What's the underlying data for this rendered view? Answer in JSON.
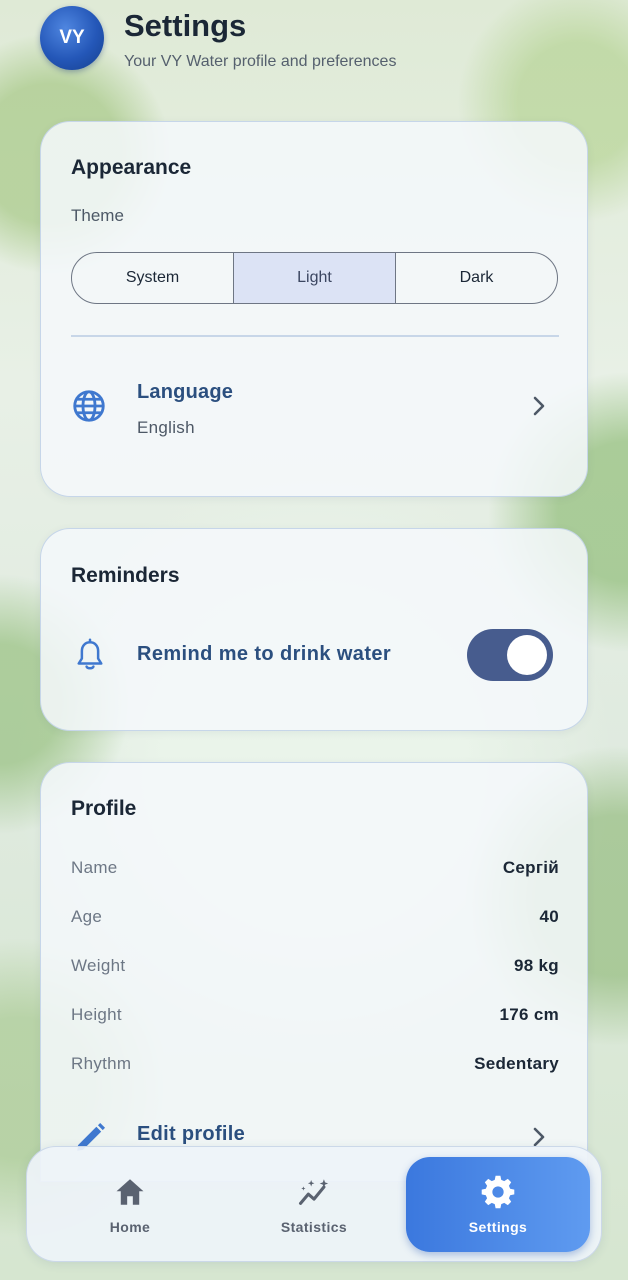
{
  "header": {
    "avatar_initials": "VY",
    "title": "Settings",
    "subtitle": "Your VY Water profile and preferences"
  },
  "appearance": {
    "title": "Appearance",
    "theme_label": "Theme",
    "theme_options": [
      "System",
      "Light",
      "Dark"
    ],
    "theme_selected": "Light",
    "language_title": "Language",
    "language_value": "English"
  },
  "reminders": {
    "title": "Reminders",
    "remind_label": "Remind me to drink water",
    "remind_enabled": true
  },
  "profile": {
    "title": "Profile",
    "rows": [
      {
        "key": "Name",
        "value": "Сергій"
      },
      {
        "key": "Age",
        "value": "40"
      },
      {
        "key": "Weight",
        "value": "98 kg"
      },
      {
        "key": "Height",
        "value": "176 cm"
      },
      {
        "key": "Rhythm",
        "value": "Sedentary"
      }
    ],
    "edit_label": "Edit profile"
  },
  "nav": {
    "items": [
      {
        "label": "Home",
        "icon": "home-icon"
      },
      {
        "label": "Statistics",
        "icon": "statistics-icon"
      },
      {
        "label": "Settings",
        "icon": "gear-icon"
      }
    ],
    "active": "Settings"
  },
  "colors": {
    "accent": "#3b78de",
    "toggle_on": "#475c8e",
    "link_text": "#2b4f7f"
  }
}
